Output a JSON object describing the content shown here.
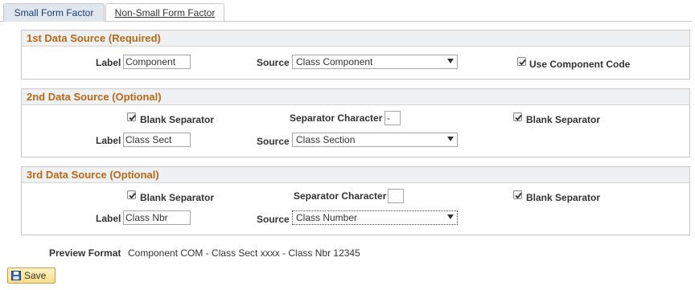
{
  "tabs": {
    "active": "Small Form Factor",
    "inactive": "Non-Small Form Factor"
  },
  "group1": {
    "header": "1st Data Source (Required)",
    "label_text": "Label",
    "label_value": "Component",
    "source_text": "Source",
    "source_value": "Class Component",
    "use_component_code": "Use Component Code",
    "use_component_code_checked": true
  },
  "group2": {
    "header": "2nd Data Source (Optional)",
    "blank_sep_1": "Blank Separator",
    "blank_sep_1_checked": true,
    "sep_char_label": "Separator Character",
    "sep_char_value": "-",
    "blank_sep_2": "Blank Separator",
    "blank_sep_2_checked": true,
    "label_text": "Label",
    "label_value": "Class Sect",
    "source_text": "Source",
    "source_value": "Class Section"
  },
  "group3": {
    "header": "3rd Data Source (Optional)",
    "blank_sep_1": "Blank Separator",
    "blank_sep_1_checked": true,
    "sep_char_label": "Separator Character",
    "sep_char_value": "",
    "blank_sep_2": "Blank Separator",
    "blank_sep_2_checked": true,
    "label_text": "Label",
    "label_value": "Class Nbr",
    "source_text": "Source",
    "source_value": "Class Number"
  },
  "preview": {
    "label": "Preview Format",
    "value": "Component COM - Class Sect xxxx - Class Nbr 12345"
  },
  "save": {
    "label": "Save"
  },
  "colors": {
    "header_text": "#b36a1b",
    "tab_active_bg": "#dfe6ee",
    "save_bg": "#f7dd8a"
  }
}
